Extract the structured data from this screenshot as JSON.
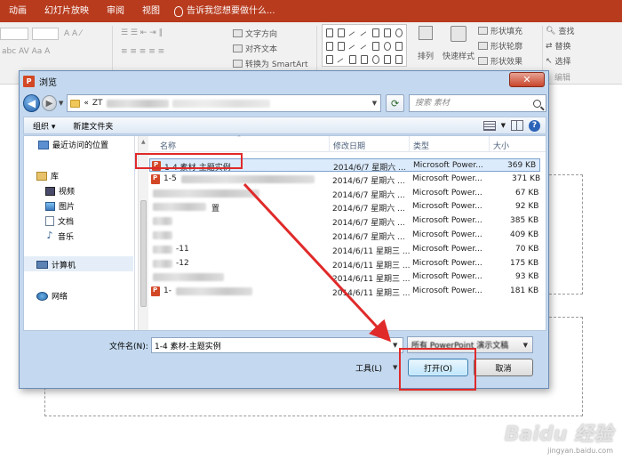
{
  "ppt": {
    "tabs": [
      "动画",
      "幻灯片放映",
      "审阅",
      "视图"
    ],
    "tell_me": "告诉我您想要做什么...",
    "ribbon": {
      "text_direction": "文字方向",
      "align_text": "对齐文本",
      "convert_smartart": "转换为 SmartArt",
      "arrange": "排列",
      "quick_styles": "快速样式",
      "shape_fill": "形状填充",
      "shape_outline": "形状轮廓",
      "shape_effects": "形状效果",
      "find": "查找",
      "replace": "替换",
      "select": "选择",
      "editing": "编辑"
    }
  },
  "dialog": {
    "title": "浏览",
    "close_glyph": "✕",
    "address_prefix": "«",
    "address_folder": "ZT",
    "search_placeholder": "搜索 素材",
    "toolbar": {
      "organize": "组织 ▾",
      "new_folder": "新建文件夹"
    },
    "nav": {
      "recent": "最近访问的位置",
      "libraries": "库",
      "videos": "视频",
      "pictures": "图片",
      "documents": "文档",
      "music": "音乐",
      "computer": "计算机",
      "network": "网络"
    },
    "columns": {
      "name": "名称",
      "modified": "修改日期",
      "type": "类型",
      "size": "大小"
    },
    "files": [
      {
        "name": "1-4 素材-主题实例",
        "date": "2014/6/7 星期六 ...",
        "type": "Microsoft Power...",
        "size": "369 KB"
      },
      {
        "name": "1-5",
        "date": "2014/6/7 星期六 ...",
        "type": "Microsoft Power...",
        "size": "371 KB"
      },
      {
        "name": "",
        "date": "2014/6/7 星期六 ...",
        "type": "Microsoft Power...",
        "size": "67 KB"
      },
      {
        "name": "置",
        "date": "2014/6/7 星期六 ...",
        "type": "Microsoft Power...",
        "size": "92 KB"
      },
      {
        "name": "",
        "date": "2014/6/7 星期六 ...",
        "type": "Microsoft Power...",
        "size": "385 KB"
      },
      {
        "name": "",
        "date": "2014/6/7 星期六 ...",
        "type": "Microsoft Power...",
        "size": "409 KB"
      },
      {
        "name": "-11",
        "date": "2014/6/11 星期三 ...",
        "type": "Microsoft Power...",
        "size": "70 KB"
      },
      {
        "name": "-12",
        "date": "2014/6/11 星期三 ...",
        "type": "Microsoft Power...",
        "size": "175 KB"
      },
      {
        "name": "",
        "date": "2014/6/11 星期三 ...",
        "type": "Microsoft Power...",
        "size": "93 KB"
      },
      {
        "name": "1-",
        "date": "2014/6/11 星期三 ...",
        "type": "Microsoft Power...",
        "size": "181 KB"
      }
    ],
    "filename_label": "文件名(N):",
    "filename_value": "1-4 素材-主题实例",
    "filetype_value": "所有 PowerPoint 演示文稿",
    "tools_label": "工具(L)",
    "open_button": "打开(O)",
    "cancel_button": "取消"
  },
  "watermark": {
    "logo": "Baidu 经验",
    "url": "jingyan.baidu.com"
  },
  "colors": {
    "ribbon_tab_bg": "#b83b1e",
    "dialog_frame": "#c4d9ef",
    "selection": "#dcebfc",
    "annotation_red": "#e02a2a"
  }
}
